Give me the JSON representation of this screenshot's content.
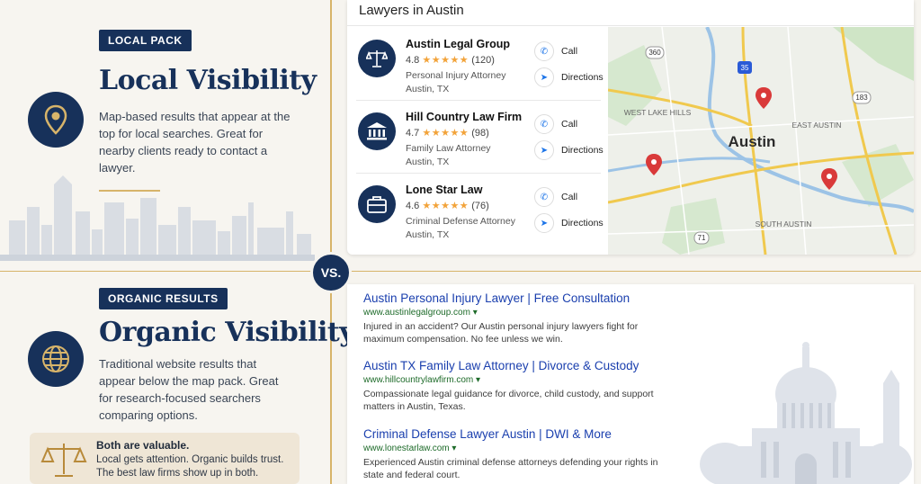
{
  "local": {
    "badge": "LOCAL PACK",
    "heading": "Local Visibility",
    "description": "Map-based results that appear at the top for local searches. Great for nearby clients ready to contact a lawyer.",
    "icon": "location-pin-icon"
  },
  "organic": {
    "badge": "ORGANIC RESULTS",
    "heading": "Organic Visibility",
    "description": "Traditional website results that appear below the map pack. Great for research-focused searchers comparing options.",
    "icon": "globe-icon"
  },
  "callout": {
    "title": "Both are valuable.",
    "body": "Local gets attention. Organic builds trust. The best law firms show up in both."
  },
  "vs_label": "VS.",
  "pack": {
    "title": "Lawyers in Austin",
    "call_label": "Call",
    "directions_label": "Directions",
    "listings": [
      {
        "name": "Austin Legal Group",
        "rating": "4.8",
        "stars": "★★★★★",
        "reviews": "(120)",
        "type": "Personal Injury Attorney",
        "location": "Austin, TX",
        "icon": "scales-icon"
      },
      {
        "name": "Hill Country Law Firm",
        "rating": "4.7",
        "stars": "★★★★★",
        "reviews": "(98)",
        "type": "Family Law Attorney",
        "location": "Austin, TX",
        "icon": "courthouse-icon"
      },
      {
        "name": "Lone Star Law",
        "rating": "4.6",
        "stars": "★★★★★",
        "reviews": "(76)",
        "type": "Criminal Defense Attorney",
        "location": "Austin, TX",
        "icon": "briefcase-icon"
      }
    ],
    "map": {
      "city": "Austin",
      "labels": [
        "WEST LAKE HILLS",
        "EAST AUSTIN",
        "SOUTH AUSTIN"
      ],
      "shields": [
        "360",
        "35",
        "183",
        "71"
      ]
    }
  },
  "results": [
    {
      "title": "Austin Personal Injury Lawyer | Free Consultation",
      "url": "www.austinlegalgroup.com ▾",
      "desc": "Injured in an accident? Our Austin personal injury lawyers fight for maximum compensation. No fee unless we win."
    },
    {
      "title": "Austin TX Family Law Attorney | Divorce & Custody",
      "url": "www.hillcountrylawfirm.com ▾",
      "desc": "Compassionate legal guidance for divorce, child custody, and support matters in Austin, Texas."
    },
    {
      "title": "Criminal Defense Lawyer Austin | DWI & More",
      "url": "www.lonestarlaw.com ▾",
      "desc": "Experienced Austin criminal defense attorneys defending your rights in state and federal court."
    }
  ],
  "colors": {
    "navy": "#17315a",
    "gold": "#d7b46a",
    "link": "#1a3fae",
    "pin": "#d93a3a"
  }
}
